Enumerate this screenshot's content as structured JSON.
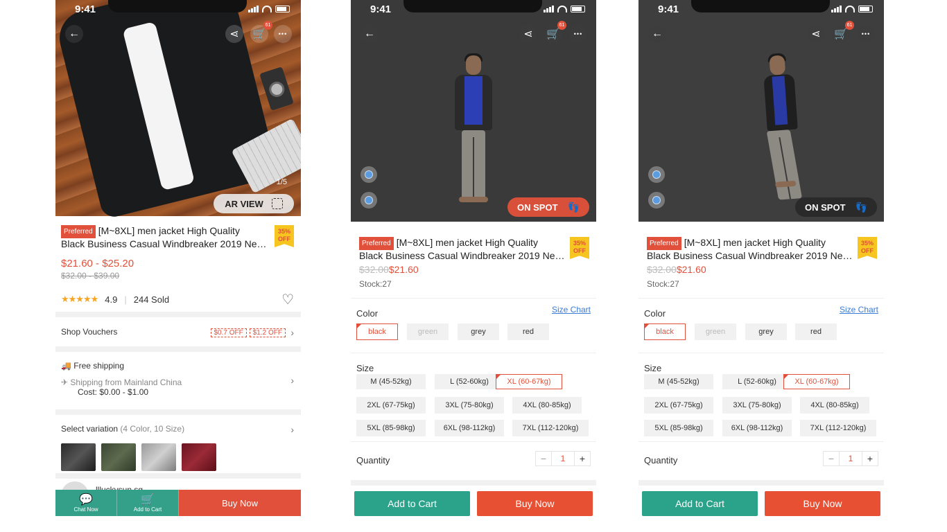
{
  "status": {
    "time": "9:41"
  },
  "cart_count": "61",
  "product": {
    "preferred": "Preferred",
    "title_line1": "[M~8XL] men jacket High Quality",
    "title_line2": "Black Business Casual Windbreaker 2019 New...",
    "off_badge_pct": "35%",
    "off_badge_text": "OFF"
  },
  "listing": {
    "image_index": "1/5",
    "ar_view": "AR VIEW",
    "price_range": "$21.60 - $25.20",
    "old_price_range": "$32.00 - $39.00",
    "rating": "4.9",
    "sold": "244 Sold",
    "shop_vouchers": "Shop Vouchers",
    "voucher1": "$0.7 OFF",
    "voucher2": "$1.2 OFF",
    "free_shipping": "Free shipping",
    "shipping_from": "Shipping from Mainland China",
    "cost": "Cost: $0.00 - $1.00",
    "select_variation": "Select variation",
    "variation_count": "(4 Color, 10 Size)",
    "seller": "llluckysun.sg",
    "chat_now": "Chat Now",
    "add_to_cart_small": "Add to Cart",
    "buy_now": "Buy Now"
  },
  "ar": {
    "on_spot": "ON SPOT",
    "old_price": "$32.00",
    "price": "$21.60",
    "stock": "Stock:27",
    "color_label": "Color",
    "size_chart": "Size Chart",
    "colors": [
      "black",
      "green",
      "grey",
      "red"
    ],
    "size_label": "Size",
    "sizes": [
      "M (45-52kg)",
      "L (52-60kg)",
      "XL (60-67kg)",
      "2XL (67-75kg)",
      "3XL (75-80kg)",
      "4XL (80-85kg)",
      "5XL (85-98kg)",
      "6XL (98-112kg)",
      "7XL (112-120kg)"
    ],
    "quantity_label": "Quantity",
    "quantity": "1",
    "minus": "−",
    "plus": "+",
    "add_to_cart": "Add to Cart",
    "buy_now": "Buy Now"
  },
  "colors": {
    "accent": "#e0503a",
    "green": "#2ba38a",
    "badge": "#f7c520",
    "link": "#3a7bd5"
  },
  "icons": [
    "back-arrow-icon",
    "share-icon",
    "cart-icon",
    "more-icon",
    "heart-icon",
    "chevron-right-icon",
    "truck-icon",
    "plane-icon",
    "chat-icon",
    "rotate-icon",
    "search-icon",
    "footprints-icon",
    "ar-cube-icon"
  ]
}
